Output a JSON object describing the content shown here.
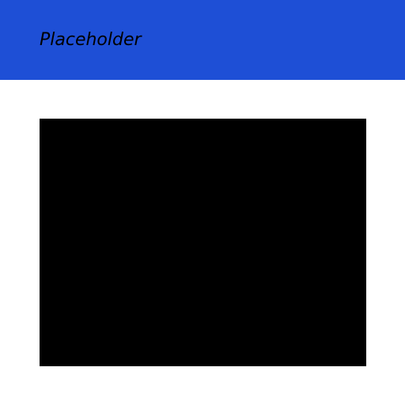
{
  "header": {
    "title": "Placeholder",
    "background_color": "#1e4fd6"
  },
  "main": {
    "media_placeholder_color": "#000000"
  }
}
